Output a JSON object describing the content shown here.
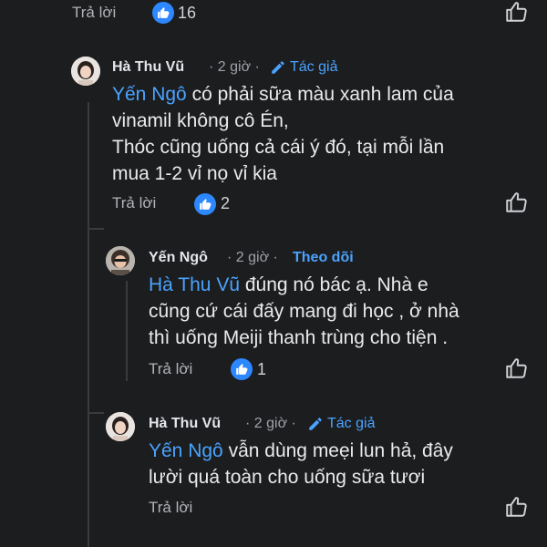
{
  "top": {
    "reply": "Trả lời",
    "like_count": "16"
  },
  "c1": {
    "author": "Hà Thu Vũ",
    "time": "· 2 giờ ·",
    "role": "Tác giả",
    "mention": "Yến Ngô",
    "line1_rest": " có phải sữa màu xanh lam của",
    "line2": "vinamil không cô Én,",
    "line3": "Thóc cũng uống cả cái ý đó, tại mỗi lần",
    "line4": "mua 1-2 vỉ nọ vỉ kia",
    "reply": "Trả lời",
    "like_count": "2"
  },
  "c2": {
    "author": "Yến Ngô",
    "time": "· 2 giờ ·",
    "role": "Theo dõi",
    "mention": "Hà Thu Vũ",
    "line1_rest": "  đúng nó bác ạ. Nhà e",
    "line2": "cũng cứ cái đấy mang đi học , ở nhà",
    "line3": "thì uống Meiji  thanh trùng cho tiện .",
    "reply": "Trả lời",
    "like_count": "1"
  },
  "c3": {
    "author": "Hà Thu Vũ",
    "time": "· 2 giờ ·",
    "role": "Tác giả",
    "mention": "Yến Ngô",
    "line1_rest": " vẫn dùng meẹi lun hả, đây",
    "line2": "lười quá toàn cho uống sữa tươi",
    "reply": "Trả lời"
  },
  "colors": {
    "background": "#1c1d1f",
    "accent": "#4aa3ff",
    "like_badge": "#2d88ff"
  },
  "icons": [
    "like-badge-icon",
    "thumbs-up-outline-icon",
    "pencil-icon",
    "avatar"
  ]
}
